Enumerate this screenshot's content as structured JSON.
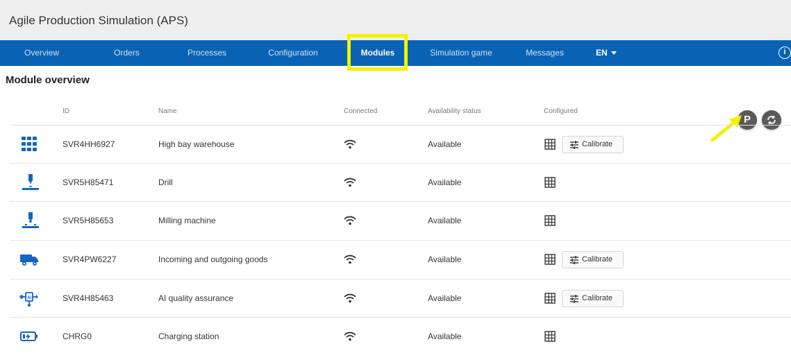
{
  "app": {
    "title": "Agile Production Simulation (APS)"
  },
  "nav": {
    "items": [
      "Overview",
      "Orders",
      "Processes",
      "Configuration",
      "Modules",
      "Simulation game",
      "Messages"
    ],
    "active": "Modules",
    "language": "EN"
  },
  "page": {
    "section_title": "Module overview"
  },
  "table": {
    "headers": {
      "id": "ID",
      "name": "Name",
      "connected": "Connected",
      "availability": "Availability status",
      "configured": "Configured"
    },
    "rows": [
      {
        "icon": "high-bay-warehouse-icon",
        "id": "SVR4HH6927",
        "name": "High bay warehouse",
        "connected": "wifi-icon",
        "status": "Available",
        "calibrate": "Calibrate"
      },
      {
        "icon": "drill-icon",
        "id": "SVR5H85471",
        "name": "Drill",
        "connected": "wifi-icon",
        "status": "Available",
        "calibrate": null
      },
      {
        "icon": "milling-machine-icon",
        "id": "SVR5H85653",
        "name": "Milling machine",
        "connected": "wifi-icon",
        "status": "Available",
        "calibrate": null
      },
      {
        "icon": "truck-icon",
        "id": "SVR4PW6227",
        "name": "Incoming and outgoing goods",
        "connected": "wifi-icon",
        "status": "Available",
        "calibrate": "Calibrate"
      },
      {
        "icon": "ai-chip-icon",
        "id": "SVR4H85463",
        "name": "AI quality assurance",
        "connected": "wifi-icon",
        "status": "Available",
        "calibrate": "Calibrate"
      },
      {
        "icon": "battery-charging-icon",
        "id": "CHRG0",
        "name": "Charging station",
        "connected": "wifi-icon",
        "status": "Available",
        "calibrate": null
      }
    ]
  },
  "actions": {
    "p_button": "P",
    "sync_button": "sync-icon"
  },
  "colors": {
    "nav_bg": "#0a62b5",
    "highlight": "#f3f300",
    "icon_blue": "#1565c0"
  }
}
